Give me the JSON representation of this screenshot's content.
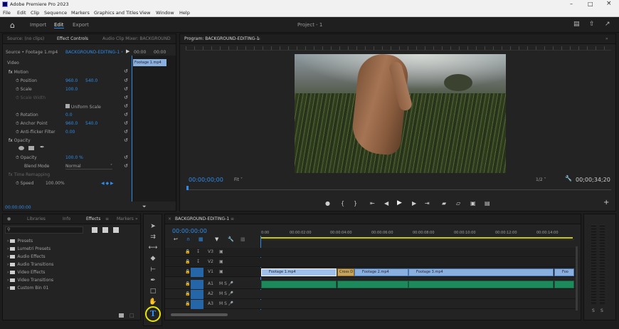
{
  "app": {
    "title": "Adobe Premiere Pro 2023",
    "project_title": "Project - 1"
  },
  "menu": [
    "File",
    "Edit",
    "Clip",
    "Sequence",
    "Markers",
    "Graphics and Titles",
    "View",
    "Window",
    "Help"
  ],
  "workspace": {
    "import": "Import",
    "edit": "Edit",
    "export": "Export"
  },
  "source_panel": {
    "tabs": [
      "Source: (no clips)",
      "Effect Controls",
      "Audio Clip Mixer: BACKGROUND",
      "Metadata"
    ],
    "active_tab": "Effect Controls",
    "source_label": "Source • Footage 1.mp4",
    "seq_link": "BACKGROUND-EDITING-1 • Footage 1.mp4",
    "mini_time": "00:00",
    "mini_time2": "00:00",
    "clip_chip": "Footage 1.mp4",
    "video_label": "Video",
    "fx_motion": "Motion",
    "props": [
      {
        "name": "Position",
        "v1": "960.0",
        "v2": "540.0"
      },
      {
        "name": "Scale",
        "v1": "100.0",
        "v2": ""
      },
      {
        "name": "Scale Width",
        "v1": "",
        "v2": ""
      },
      {
        "name": "Rotation",
        "v1": "0.0",
        "v2": ""
      },
      {
        "name": "Anchor Point",
        "v1": "960.0",
        "v2": "540.0"
      },
      {
        "name": "Anti-flicker Filter",
        "v1": "0.00",
        "v2": ""
      }
    ],
    "uniform_scale": "Uniform Scale",
    "opacity": "Opacity",
    "opacity_val": "100.0 %",
    "blend_label": "Blend Mode",
    "blend_val": "Normal",
    "time_remap": "Time Remapping",
    "speed_label": "Speed",
    "speed_val": "100.00%",
    "timecode": "00:00:00:00"
  },
  "program": {
    "title": "Program: BACKGROUND-EDITING-1",
    "timecode": "00:00;00;00",
    "fit": "Fit",
    "quality": "1/2",
    "duration": "00;00;34;20"
  },
  "project_panel": {
    "tabs": [
      "Project: Untitled",
      "Libraries",
      "Info",
      "Effects",
      "Markers"
    ],
    "active_tab": "Effects",
    "search_placeholder": "",
    "folders": [
      "Presets",
      "Lumetri Presets",
      "Audio Effects",
      "Audio Transitions",
      "Video Effects",
      "Video Transitions",
      "Custom Bin 01"
    ]
  },
  "timeline": {
    "title": "BACKGROUND-EDITING-1",
    "timecode": "00:00:00:00",
    "ruler": [
      "0:00",
      "00:00:02:00",
      "00:00:04:00",
      "00:00:06:00",
      "00:00:08:00",
      "00:00:10:00",
      "00:00:12:00",
      "00:00:14:00"
    ],
    "v1_clips": [
      "Footage 1.mp4",
      "Cross D",
      "Footage 2.mp4",
      "Footage 3.mp4",
      "Foo"
    ],
    "track_labels": {
      "v3": "V3",
      "v2": "V2",
      "v1": "V1",
      "a1": "A1",
      "a2": "A2",
      "a3": "A3"
    }
  },
  "meter": {
    "labels": [
      "S",
      "S"
    ]
  },
  "colors": {
    "accent": "#2d8ceb",
    "clip": "#8ab0e0",
    "audio": "#1c8a5a",
    "highlight": "#e8e600"
  }
}
